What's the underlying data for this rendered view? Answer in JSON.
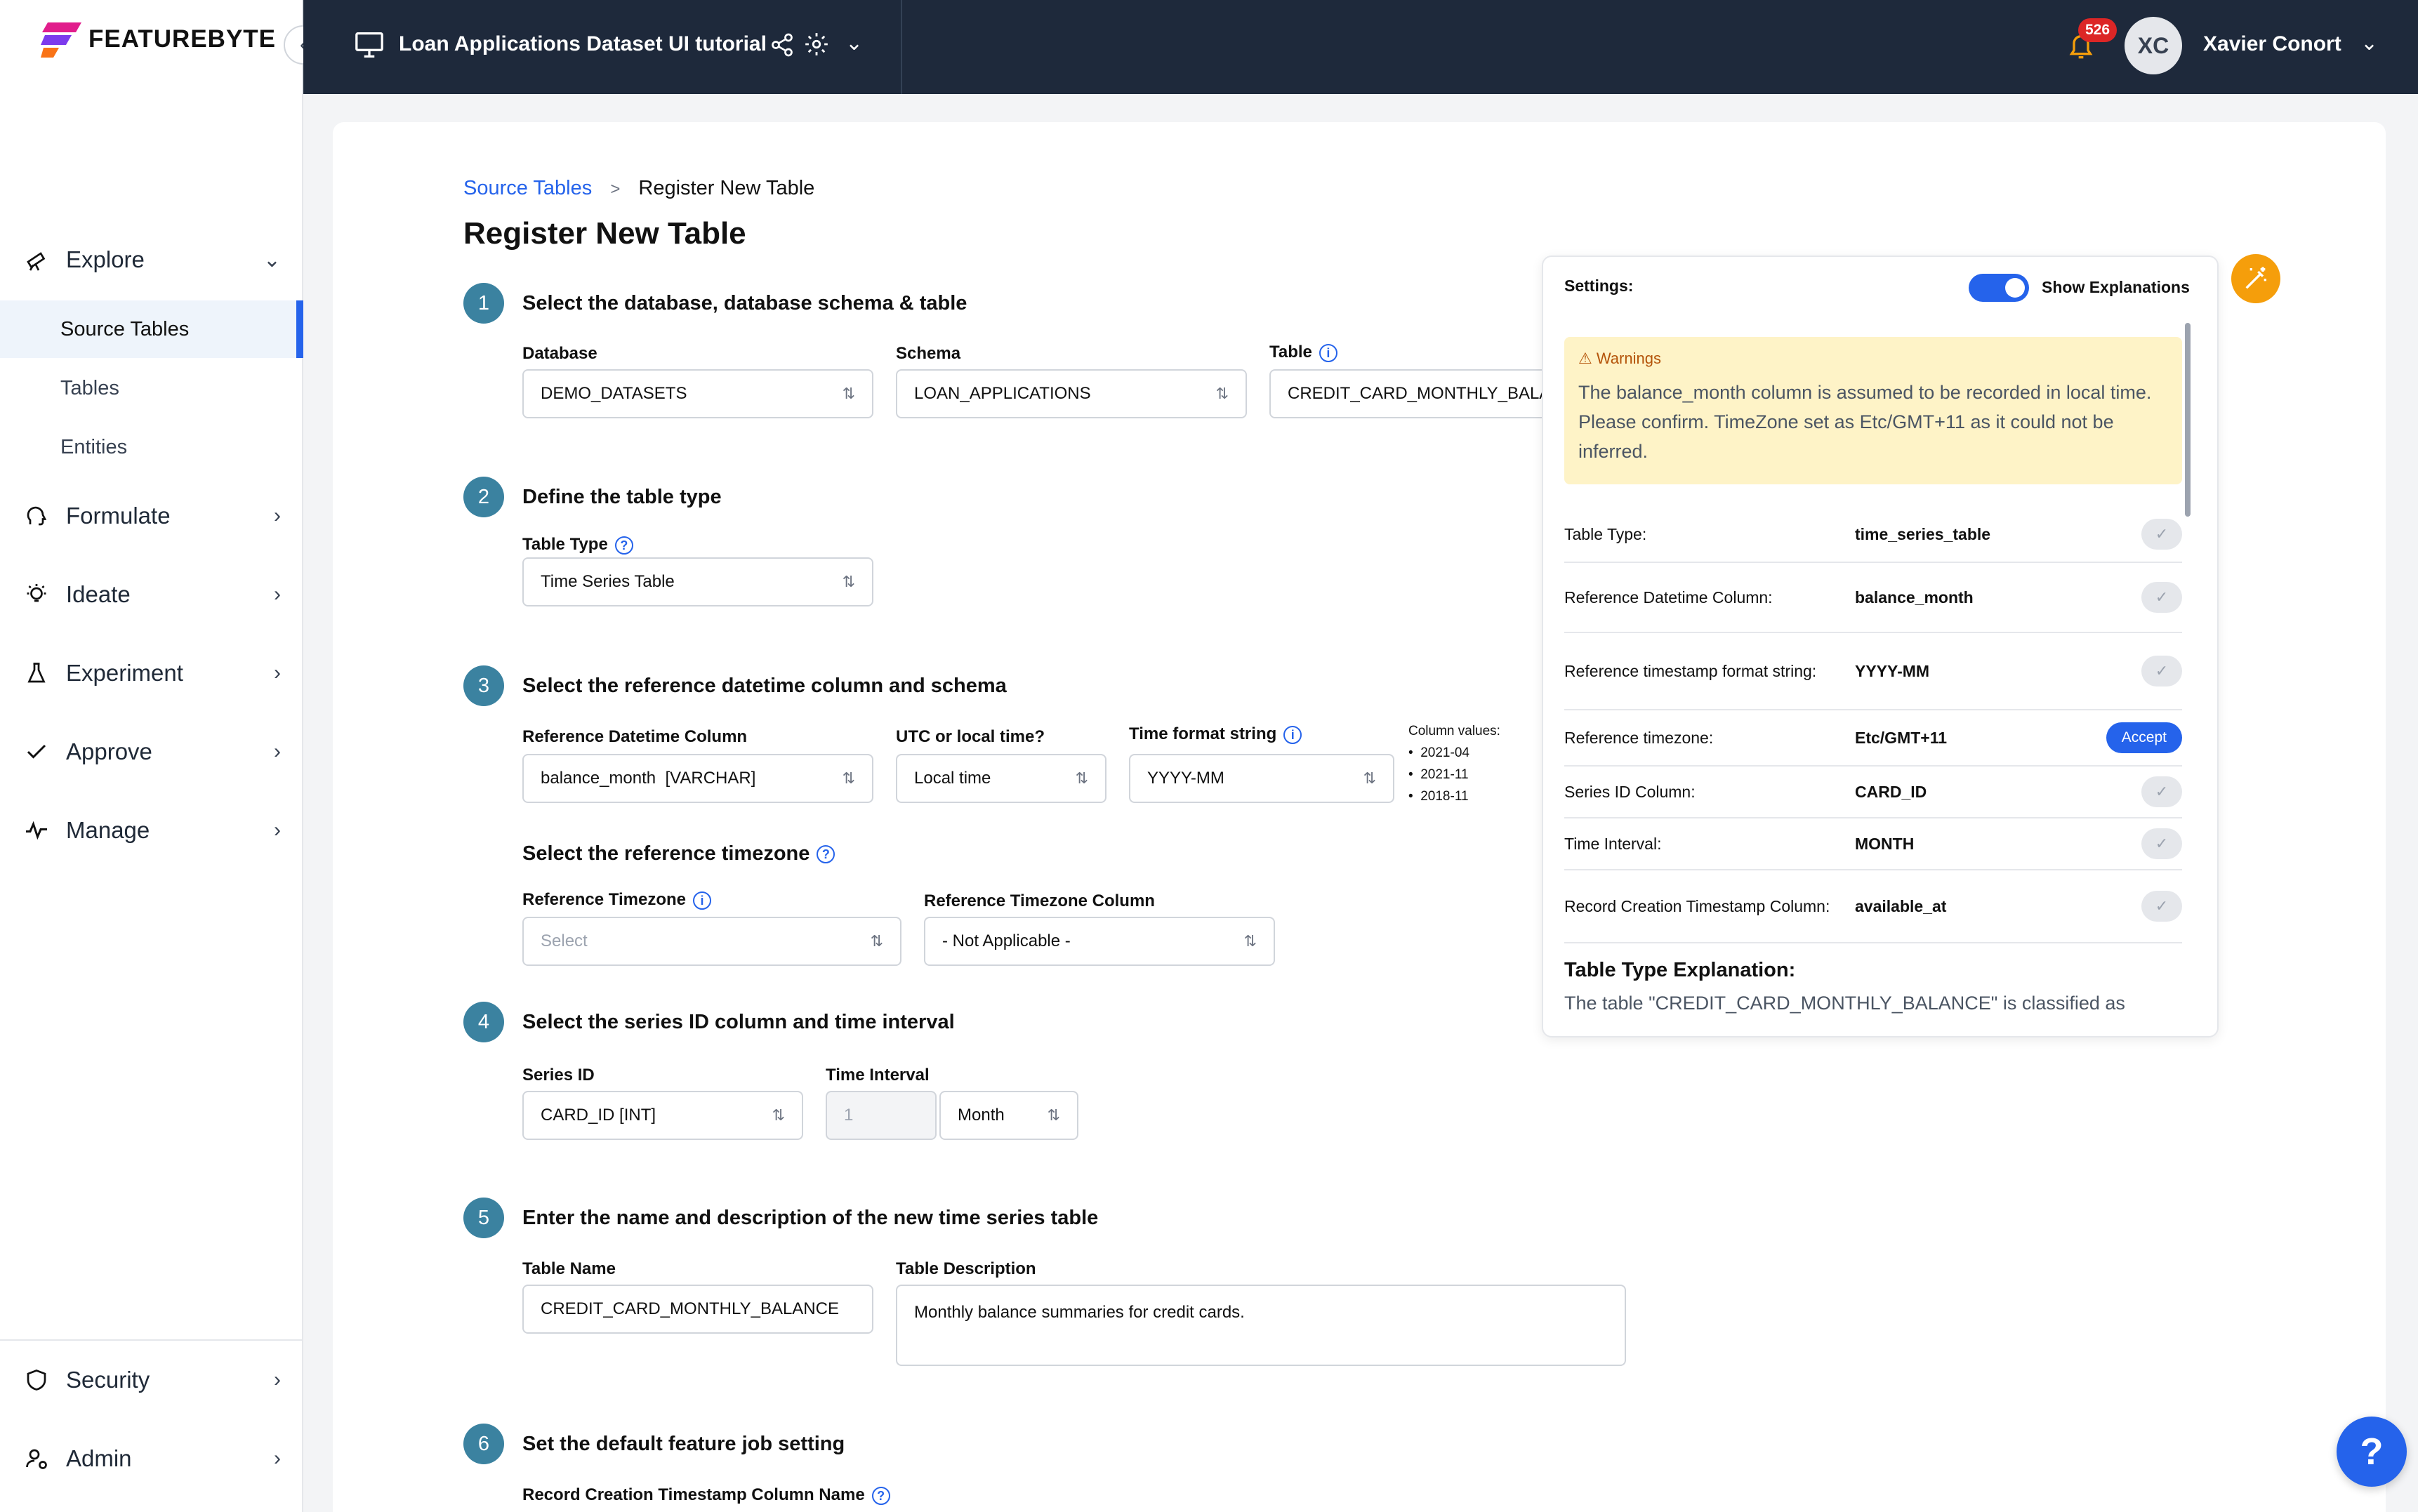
{
  "app": {
    "logo_text": "FEATUREBYTE"
  },
  "topbar": {
    "title": "Loan Applications Dataset UI tutorial",
    "notif_count": "526",
    "avatar_initials": "XC",
    "user_name": "Xavier Conort"
  },
  "sidebar": {
    "explore": "Explore",
    "sub": [
      "Source Tables",
      "Tables",
      "Entities"
    ],
    "items": [
      {
        "label": "Formulate"
      },
      {
        "label": "Ideate"
      },
      {
        "label": "Experiment"
      },
      {
        "label": "Approve"
      },
      {
        "label": "Manage"
      }
    ],
    "bottom": [
      {
        "label": "Security"
      },
      {
        "label": "Admin"
      }
    ]
  },
  "breadcrumb": {
    "parent": "Source Tables",
    "sep": ">",
    "current": "Register New Table"
  },
  "page_title": "Register New Table",
  "steps": {
    "s1": {
      "num": "1",
      "title": "Select the database, database schema & table",
      "db_label": "Database",
      "db_value": "DEMO_DATASETS",
      "schema_label": "Schema",
      "schema_value": "LOAN_APPLICATIONS",
      "table_label": "Table",
      "table_value": "CREDIT_CARD_MONTHLY_BALA"
    },
    "s2": {
      "num": "2",
      "title": "Define the table type",
      "type_label": "Table Type",
      "type_value": "Time Series Table"
    },
    "s3": {
      "num": "3",
      "title": "Select the reference datetime column and schema",
      "ref_label": "Reference Datetime Column",
      "ref_value": "balance_month  [VARCHAR]",
      "utc_label": "UTC or local time?",
      "utc_value": "Local time",
      "fmt_label": "Time format string",
      "fmt_value": "YYYY-MM",
      "colvals_label": "Column values:",
      "colvals": [
        "2021-04",
        "2021-11",
        "2018-11"
      ],
      "tz_title": "Select the reference timezone",
      "tz_label": "Reference Timezone",
      "tz_placeholder": "Select",
      "tzcol_label": "Reference Timezone Column",
      "tzcol_value": "- Not Applicable -"
    },
    "s4": {
      "num": "4",
      "title": "Select the series ID column and time interval",
      "sid_label": "Series ID",
      "sid_value": "CARD_ID [INT]",
      "ti_label": "Time Interval",
      "ti_num": "1",
      "ti_unit": "Month"
    },
    "s5": {
      "num": "5",
      "title": "Enter the name and description of the new time series table",
      "name_label": "Table Name",
      "name_value": "CREDIT_CARD_MONTHLY_BALANCE",
      "desc_label": "Table Description",
      "desc_value": "Monthly balance summaries for credit cards."
    },
    "s6": {
      "num": "6",
      "title": "Set the default feature job setting",
      "rc_label": "Record Creation Timestamp Column Name"
    }
  },
  "panel": {
    "settings_label": "Settings:",
    "toggle_label": "Show Explanations",
    "warn_title": "Warnings",
    "warn_text": "The balance_month column is assumed to be recorded in local time. Please confirm. TimeZone set as Etc/GMT+11 as it could not be inferred.",
    "rows": [
      {
        "k": "Table Type:",
        "v": "time_series_table"
      },
      {
        "k": "Reference Datetime Column:",
        "v": "balance_month"
      },
      {
        "k": "Reference timestamp format string:",
        "v": "YYYY-MM"
      },
      {
        "k": "Reference timezone:",
        "v": "Etc/GMT+11",
        "action": "Accept"
      },
      {
        "k": "Series ID Column:",
        "v": "CARD_ID"
      },
      {
        "k": "Time Interval:",
        "v": "MONTH"
      },
      {
        "k": "Record Creation Timestamp Column:",
        "v": "available_at"
      }
    ],
    "expl_title": "Table Type Explanation:",
    "expl_text": "The table \"CREDIT_CARD_MONTHLY_BALANCE\" is classified as"
  },
  "help_label": "?",
  "colors": {
    "accent": "#2563eb",
    "step": "#3b82a0",
    "topbar": "#1e293b",
    "warning_bg": "#fef3c7",
    "magic": "#f59e0b"
  }
}
